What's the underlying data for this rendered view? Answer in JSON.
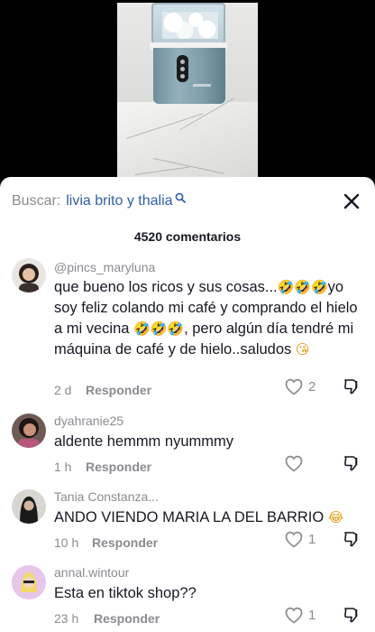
{
  "search": {
    "label": "Buscar:",
    "query": "livia brito y thalia"
  },
  "comments_count": "4520 comentarios",
  "comments": [
    {
      "username": "@pincs_maryluna",
      "text_parts": [
        "que bueno los ricos y sus cosas...",
        "🤣🤣🤣",
        "yo soy feliz colando mi café y comprando el hielo a mi vecina ",
        "🤣🤣🤣",
        ", pero algún día tendré mi máquina de café y de hielo..saludos ",
        "😘"
      ],
      "time": "2 d",
      "reply": "Responder",
      "likes": "2"
    },
    {
      "username": "dyahranie25",
      "text": "aldente hemmm nyummmy",
      "time": "1 h",
      "reply": "Responder",
      "likes": ""
    },
    {
      "username": "Tania Constanza...",
      "text_parts": [
        "ANDO VIENDO MARIA LA DEL BARRIO ",
        "😂"
      ],
      "time": "10 h",
      "reply": "Responder",
      "likes": "1"
    },
    {
      "username": "annal.wintour",
      "text": "Esta en tiktok shop??",
      "time": "23 h",
      "reply": "Responder",
      "likes": "1"
    }
  ],
  "icons": {
    "search": "search-icon",
    "close": "close-icon",
    "like": "heart-outline-icon",
    "dislike": "thumbs-down-icon"
  },
  "colors": {
    "sheet_bg": "#ffffff",
    "search_query": "#2f5fa6",
    "muted": "#8a8b91",
    "text": "#161823"
  }
}
